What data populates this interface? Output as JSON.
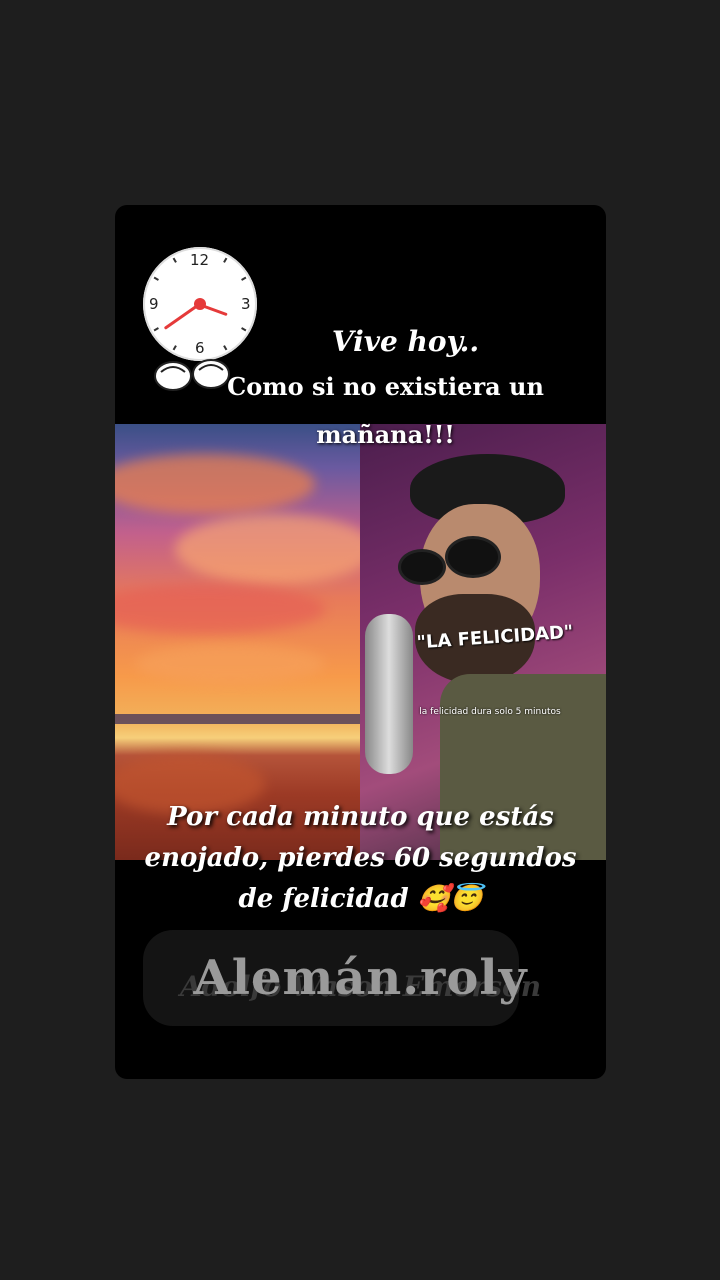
{
  "story": {
    "clock_numbers": [
      "12",
      "3",
      "6",
      "9"
    ],
    "title_line1": "Vive hoy..",
    "title_line2": "Como si no existiera un mañana!!!",
    "video_caption_title": "\"LA FELICIDAD\"",
    "video_caption_sub": "la felicidad dura solo 5 minutos",
    "quote": "Por cada minuto que estás enojado, pierdes 60 segundos de felicidad 🥰😇",
    "watermark": "Alemán.roly",
    "watermark_ghost": "Adolfo Wason Emerson"
  },
  "colors": {
    "page_background": "#1e1e1e",
    "card_background": "#000000",
    "clock_hand": "#e53a3a"
  },
  "icons": [
    "clock-icon",
    "pointing-hands-icon"
  ]
}
